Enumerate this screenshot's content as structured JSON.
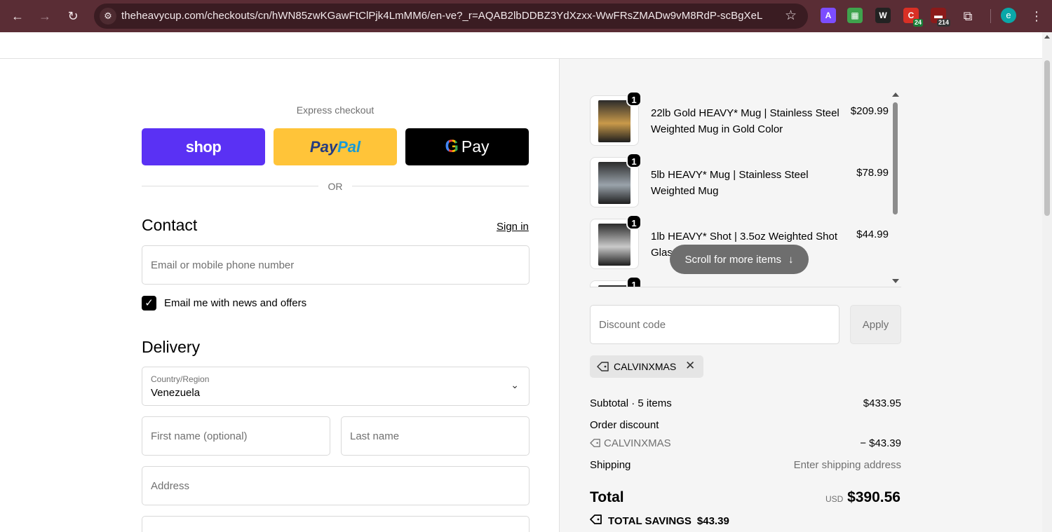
{
  "browser": {
    "url": "theheavycup.com/checkouts/cn/hWN85zwKGawFtClPjk4LmMM6/en-ve?_r=AQAB2lbDDBZ3YdXzxx-WwFRsZMADw9vM8RdP-scBgXeL",
    "profile_initial": "e",
    "extensions": [
      {
        "name": "extension-a-icon",
        "glyph": "A",
        "color": "#7c4dff"
      },
      {
        "name": "extension-kolor-icon",
        "glyph": "▦",
        "color": "#3fa34d"
      },
      {
        "name": "extension-w-icon",
        "glyph": "W",
        "color": "#222222"
      },
      {
        "name": "extension-c-icon",
        "glyph": "C",
        "color": "#d93025",
        "badge": "24",
        "badge_color": "#188038"
      },
      {
        "name": "extension-calendar-icon",
        "glyph": "▬",
        "color": "#8b1a1a",
        "badge": "214",
        "badge_color": "#333333"
      }
    ]
  },
  "express": {
    "label": "Express checkout",
    "shop_label": "shop",
    "paypal_part1": "Pay",
    "paypal_part2": "Pal",
    "gpay_g": "G",
    "gpay_label": "Pay",
    "or_label": "OR"
  },
  "contact": {
    "title": "Contact",
    "sign_in": "Sign in",
    "email_placeholder": "Email or mobile phone number",
    "newsletter_label": "Email me with news and offers",
    "newsletter_checked": true
  },
  "delivery": {
    "title": "Delivery",
    "country_label": "Country/Region",
    "country_value": "Venezuela",
    "first_name_placeholder": "First name (optional)",
    "last_name_placeholder": "Last name",
    "address_placeholder": "Address"
  },
  "cart": {
    "items": [
      {
        "qty": "1",
        "name": "22lb Gold HEAVY* Mug | Stainless Steel Weighted Mug in Gold Color",
        "price": "$209.99",
        "thumb_color": "#c99a4a"
      },
      {
        "qty": "1",
        "name": "5lb HEAVY* Mug | Stainless Steel Weighted Mug",
        "price": "$78.99",
        "thumb_color": "#9aa3ab"
      },
      {
        "qty": "1",
        "name": "1lb HEAVY* Shot | 3.5oz Weighted Shot Glass",
        "price": "$44.99",
        "thumb_color": "#c9c9c9"
      },
      {
        "qty": "1",
        "name": "",
        "price": "",
        "thumb_color": "#4a5058"
      }
    ],
    "scroll_hint": "Scroll for more items"
  },
  "discount": {
    "placeholder": "Discount code",
    "apply_label": "Apply",
    "applied_code": "CALVINXMAS"
  },
  "summary": {
    "subtotal_label": "Subtotal · 5 items",
    "subtotal_value": "$433.95",
    "order_discount_label": "Order discount",
    "discount_code": "CALVINXMAS",
    "discount_value": "− $43.39",
    "shipping_label": "Shipping",
    "shipping_value": "Enter shipping address",
    "total_label": "Total",
    "currency": "USD",
    "total_value": "$390.56",
    "savings_label": "TOTAL SAVINGS",
    "savings_value": "$43.39"
  }
}
